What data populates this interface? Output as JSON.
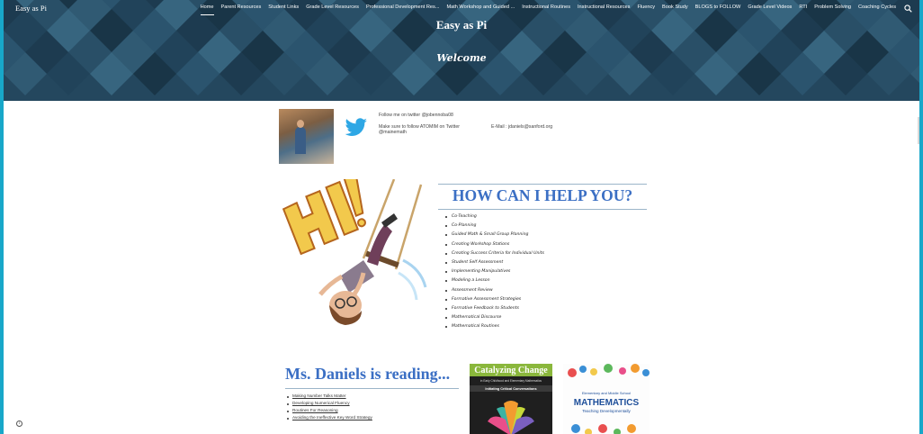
{
  "site": {
    "title": "Easy as Pi"
  },
  "nav": {
    "items": [
      {
        "label": "Home",
        "active": true
      },
      {
        "label": "Parent Resources"
      },
      {
        "label": "Student Links"
      },
      {
        "label": "Grade Level Resources"
      },
      {
        "label": "Professional Development Res..."
      },
      {
        "label": "Math Workshop and Guided ..."
      },
      {
        "label": "Instructional Routines"
      },
      {
        "label": "Instructional Resources"
      },
      {
        "label": "Fluency"
      },
      {
        "label": "Book Study"
      },
      {
        "label": "BLOGS to FOLLOW"
      },
      {
        "label": "Grade Level Videos"
      },
      {
        "label": "RTI"
      },
      {
        "label": "Problem Solving"
      },
      {
        "label": "Coaching Cycles"
      }
    ],
    "search_icon": "search-icon"
  },
  "banner": {
    "title": "Easy as Pi",
    "subtitle": "Welcome"
  },
  "intro": {
    "follow": "Follow me on twitter @jobennoba08",
    "atomim_line1": "Make sure to follow ATOMIM on Twitter",
    "atomim_line2": "@mainemath",
    "email": "E-Mail : jdaniels@sanford.org"
  },
  "help": {
    "title": "HOW CAN I HELP YOU?",
    "items": [
      "Co-Teaching",
      "Co-Planning",
      "Guided Math & Small Group Planning",
      "Creating Workshop Stations",
      "Creating Success Criteria for Individual Units",
      "Student Self Assessment",
      "Implementing Manipulatives",
      "Modeling a Lesson",
      "Assessment Review",
      "Formative Assessment Strategies",
      "Formative Feedback to Students",
      "Mathematical Discourse",
      "Mathematical Routines"
    ]
  },
  "reading": {
    "title": "Ms. Daniels is reading...",
    "links": [
      "Making Number Talks Matter",
      "Developing Numerical Fluency",
      "Routines For Reasoning",
      "Avoiding the Ineffective Key Word Strategy"
    ]
  },
  "books": {
    "book1": {
      "title": "Catalyzing Change",
      "subtitle": "in Early Childhood and Elementary Mathematics",
      "banner": "Initiating Critical Conversations"
    },
    "book2": {
      "line1": "Elementary and Middle School",
      "title": "MATHEMATICS",
      "subtitle": "Teaching Developmentally"
    }
  },
  "colors": {
    "accent_blue": "#3b6fc4",
    "page_border": "#18a7c9",
    "banner": "#24475e"
  }
}
